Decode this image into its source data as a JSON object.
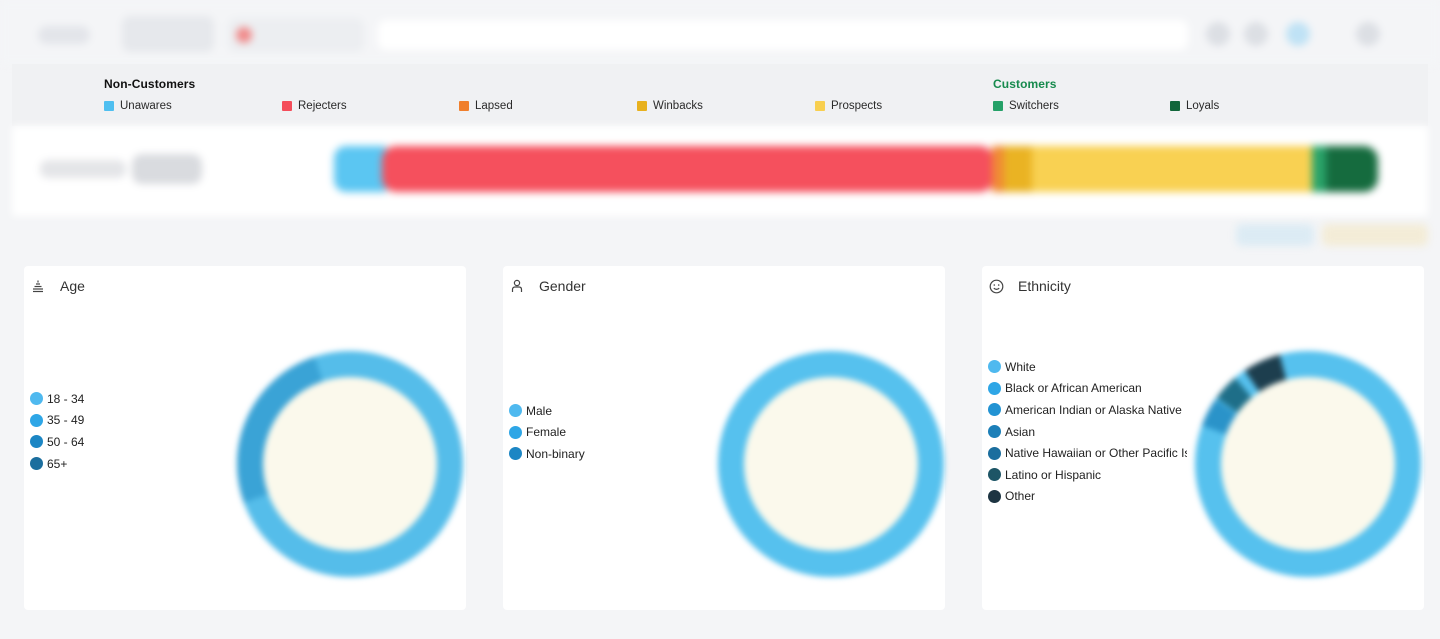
{
  "segments": {
    "non_customers_title": "Non-Customers",
    "customers_title": "Customers",
    "items": [
      {
        "label": "Unawares",
        "color": "#4fbff0",
        "group": "non"
      },
      {
        "label": "Rejecters",
        "color": "#f44d5a",
        "group": "non"
      },
      {
        "label": "Lapsed",
        "color": "#f07f2c",
        "group": "non"
      },
      {
        "label": "Winbacks",
        "color": "#e8b11e",
        "group": "non"
      },
      {
        "label": "Prospects",
        "color": "#f8cf4f",
        "group": "non"
      },
      {
        "label": "Switchers",
        "color": "#25a168",
        "group": "cust"
      },
      {
        "label": "Loyals",
        "color": "#11663a",
        "group": "cust"
      }
    ]
  },
  "cards": {
    "age": {
      "title": "Age",
      "icon": "stack-icon",
      "legend": [
        {
          "label": "18 - 34",
          "color": "#4fb9ef"
        },
        {
          "label": "35 - 49",
          "color": "#2ea6e6"
        },
        {
          "label": "50 - 64",
          "color": "#1c86c4"
        },
        {
          "label": "65+",
          "color": "#1b6e9e"
        }
      ]
    },
    "gender": {
      "title": "Gender",
      "icon": "person-icon",
      "legend": [
        {
          "label": "Male",
          "color": "#4fb9ef"
        },
        {
          "label": "Female",
          "color": "#2ea6e6"
        },
        {
          "label": "Non-binary",
          "color": "#1c86c4"
        }
      ]
    },
    "ethnicity": {
      "title": "Ethnicity",
      "icon": "smiley-icon",
      "legend": [
        {
          "label": "White",
          "color": "#4fb9ef"
        },
        {
          "label": "Black or African American",
          "color": "#2ea6e6"
        },
        {
          "label": "American Indian or Alaska Native",
          "color": "#2293d3"
        },
        {
          "label": "Asian",
          "color": "#1c7fb8"
        },
        {
          "label": "Native Hawaiian or Other Pacific Islander",
          "color": "#1b6e9e"
        },
        {
          "label": "Latino or Hispanic",
          "color": "#1d5566"
        },
        {
          "label": "Other",
          "color": "#1d3442"
        }
      ]
    }
  }
}
